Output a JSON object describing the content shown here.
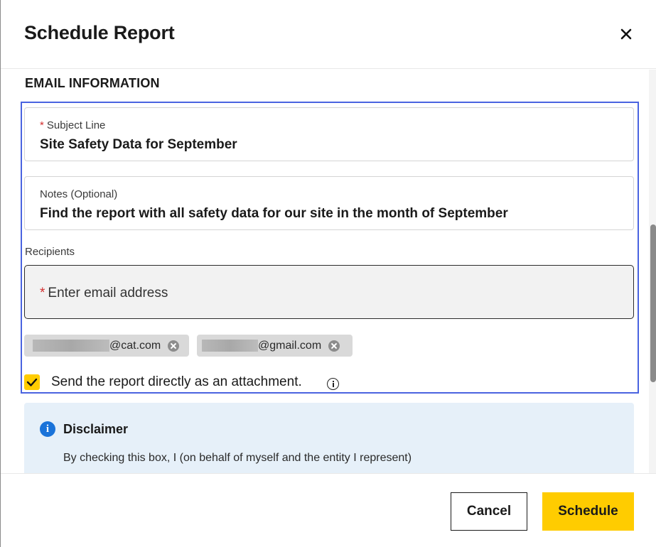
{
  "dialog": {
    "title": "Schedule Report"
  },
  "email_section": {
    "title": "EMAIL INFORMATION",
    "subject": {
      "required_mark": "*",
      "label": "Subject Line",
      "value": "Site Safety Data for September"
    },
    "notes": {
      "label": "Notes (Optional)",
      "value": "Find the report with all safety data for our site in the month of September"
    },
    "recipients": {
      "label": "Recipients",
      "required_mark": "*",
      "placeholder": "Enter email address",
      "chips": [
        {
          "domain": "@cat.com"
        },
        {
          "domain": "@gmail.com"
        }
      ]
    },
    "attachment": {
      "checked": true,
      "label": "Send the report directly as an attachment."
    }
  },
  "disclaimer": {
    "icon": "i",
    "title": "Disclaimer",
    "text": "By checking this box, I (on behalf of myself and the entity I represent)"
  },
  "footer": {
    "cancel_label": "Cancel",
    "schedule_label": "Schedule"
  },
  "colors": {
    "accent": "#ffcc00",
    "focus": "#4a63e0",
    "info": "#1a73d9",
    "required": "#d32f2f"
  }
}
